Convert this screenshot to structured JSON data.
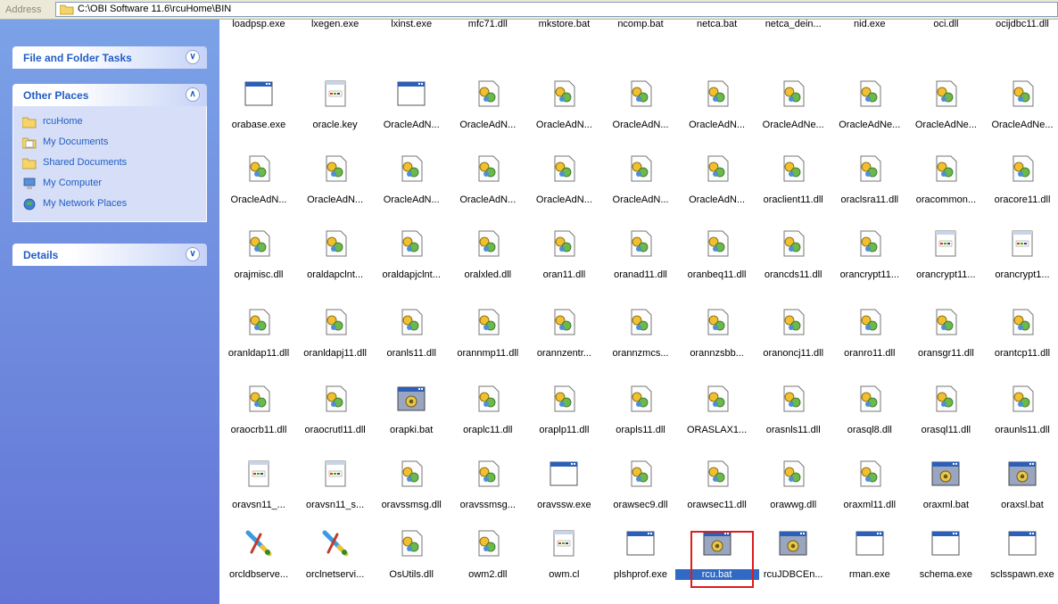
{
  "address": {
    "label": "Address",
    "path": "C:\\OBI Software 11.6\\rcuHome\\BIN"
  },
  "taskpane": {
    "file_tasks": {
      "title": "File and Folder Tasks"
    },
    "other_places": {
      "title": "Other Places",
      "items": [
        {
          "label": "rcuHome",
          "icon": "folder-icon"
        },
        {
          "label": "My Documents",
          "icon": "my-documents-icon"
        },
        {
          "label": "Shared Documents",
          "icon": "folder-icon"
        },
        {
          "label": "My Computer",
          "icon": "my-computer-icon"
        },
        {
          "label": "My Network Places",
          "icon": "network-places-icon"
        }
      ]
    },
    "details": {
      "title": "Details"
    }
  },
  "files": [
    [
      {
        "name": "loadpsp.exe",
        "icon": "exe"
      },
      {
        "name": "lxegen.exe",
        "icon": "exe"
      },
      {
        "name": "lxinst.exe",
        "icon": "exe"
      },
      {
        "name": "mfc71.dll",
        "icon": "dll"
      },
      {
        "name": "mkstore.bat",
        "icon": "bat"
      },
      {
        "name": "ncomp.bat",
        "icon": "bat"
      },
      {
        "name": "netca.bat",
        "icon": "bat"
      },
      {
        "name": "netca_dein...",
        "icon": "bat"
      },
      {
        "name": "nid.exe",
        "icon": "exe"
      },
      {
        "name": "oci.dll",
        "icon": "dll"
      },
      {
        "name": "ocijdbc11.dll",
        "icon": "dll"
      }
    ],
    [
      {
        "name": "orabase.exe",
        "icon": "exe"
      },
      {
        "name": "oracle.key",
        "icon": "doc"
      },
      {
        "name": "OracleAdN...",
        "icon": "exe"
      },
      {
        "name": "OracleAdN...",
        "icon": "dll"
      },
      {
        "name": "OracleAdN...",
        "icon": "dll"
      },
      {
        "name": "OracleAdN...",
        "icon": "dll"
      },
      {
        "name": "OracleAdN...",
        "icon": "dll"
      },
      {
        "name": "OracleAdNe...",
        "icon": "dll"
      },
      {
        "name": "OracleAdNe...",
        "icon": "dll"
      },
      {
        "name": "OracleAdNe...",
        "icon": "dll"
      },
      {
        "name": "OracleAdNe...",
        "icon": "dll"
      }
    ],
    [
      {
        "name": "OracleAdN...",
        "icon": "dll"
      },
      {
        "name": "OracleAdN...",
        "icon": "dll"
      },
      {
        "name": "OracleAdN...",
        "icon": "dll"
      },
      {
        "name": "OracleAdN...",
        "icon": "dll"
      },
      {
        "name": "OracleAdN...",
        "icon": "dll"
      },
      {
        "name": "OracleAdN...",
        "icon": "dll"
      },
      {
        "name": "OracleAdN...",
        "icon": "dll"
      },
      {
        "name": "oraclient11.dll",
        "icon": "dll"
      },
      {
        "name": "oraclsra11.dll",
        "icon": "dll"
      },
      {
        "name": "oracommon...",
        "icon": "dll"
      },
      {
        "name": "oracore11.dll",
        "icon": "dll"
      }
    ],
    [
      {
        "name": "orajmisc.dll",
        "icon": "dll"
      },
      {
        "name": "oraldapclnt...",
        "icon": "dll"
      },
      {
        "name": "oraldapjclnt...",
        "icon": "dll"
      },
      {
        "name": "oralxled.dll",
        "icon": "dll"
      },
      {
        "name": "oran11.dll",
        "icon": "dll"
      },
      {
        "name": "oranad11.dll",
        "icon": "dll"
      },
      {
        "name": "oranbeq11.dll",
        "icon": "dll"
      },
      {
        "name": "orancds11.dll",
        "icon": "dll"
      },
      {
        "name": "orancrypt11...",
        "icon": "dll"
      },
      {
        "name": "orancrypt11...",
        "icon": "doc"
      },
      {
        "name": "orancrypt1...",
        "icon": "doc"
      }
    ],
    [
      {
        "name": "oranldap11.dll",
        "icon": "dll"
      },
      {
        "name": "oranldapj11.dll",
        "icon": "dll"
      },
      {
        "name": "oranls11.dll",
        "icon": "dll"
      },
      {
        "name": "orannmp11.dll",
        "icon": "dll"
      },
      {
        "name": "orannzentr...",
        "icon": "dll"
      },
      {
        "name": "orannzmcs...",
        "icon": "dll"
      },
      {
        "name": "orannzsbb...",
        "icon": "dll"
      },
      {
        "name": "oranoncj11.dll",
        "icon": "dll"
      },
      {
        "name": "oranro11.dll",
        "icon": "dll"
      },
      {
        "name": "oransgr11.dll",
        "icon": "dll"
      },
      {
        "name": "orantcp11.dll",
        "icon": "dll"
      }
    ],
    [
      {
        "name": "oraocrb11.dll",
        "icon": "dll"
      },
      {
        "name": "oraocrutl11.dll",
        "icon": "dll"
      },
      {
        "name": "orapki.bat",
        "icon": "bat"
      },
      {
        "name": "oraplc11.dll",
        "icon": "dll"
      },
      {
        "name": "oraplp11.dll",
        "icon": "dll"
      },
      {
        "name": "orapls11.dll",
        "icon": "dll"
      },
      {
        "name": "ORASLAX1...",
        "icon": "dll"
      },
      {
        "name": "orasnls11.dll",
        "icon": "dll"
      },
      {
        "name": "orasql8.dll",
        "icon": "dll"
      },
      {
        "name": "orasql11.dll",
        "icon": "dll"
      },
      {
        "name": "oraunls11.dll",
        "icon": "dll"
      }
    ],
    [
      {
        "name": "oravsn11_...",
        "icon": "doc"
      },
      {
        "name": "oravsn11_s...",
        "icon": "doc"
      },
      {
        "name": "oravssmsg.dll",
        "icon": "dll"
      },
      {
        "name": "oravssmsg...",
        "icon": "dll"
      },
      {
        "name": "oravssw.exe",
        "icon": "exe"
      },
      {
        "name": "orawsec9.dll",
        "icon": "dll"
      },
      {
        "name": "orawsec11.dll",
        "icon": "dll"
      },
      {
        "name": "orawwg.dll",
        "icon": "dll"
      },
      {
        "name": "oraxml11.dll",
        "icon": "dll"
      },
      {
        "name": "oraxml.bat",
        "icon": "bat"
      },
      {
        "name": "oraxsl.bat",
        "icon": "bat"
      }
    ],
    [
      {
        "name": "orcldbserve...",
        "icon": "tool"
      },
      {
        "name": "orclnetservi...",
        "icon": "tool"
      },
      {
        "name": "OsUtils.dll",
        "icon": "dll"
      },
      {
        "name": "owm2.dll",
        "icon": "dll"
      },
      {
        "name": "owm.cl",
        "icon": "doc"
      },
      {
        "name": "plshprof.exe",
        "icon": "exe"
      },
      {
        "name": "rcu.bat",
        "icon": "bat",
        "selected": true
      },
      {
        "name": "rcuJDBCEn...",
        "icon": "bat"
      },
      {
        "name": "rman.exe",
        "icon": "exe"
      },
      {
        "name": "schema.exe",
        "icon": "exe"
      },
      {
        "name": "sclsspawn.exe",
        "icon": "exe"
      }
    ]
  ]
}
